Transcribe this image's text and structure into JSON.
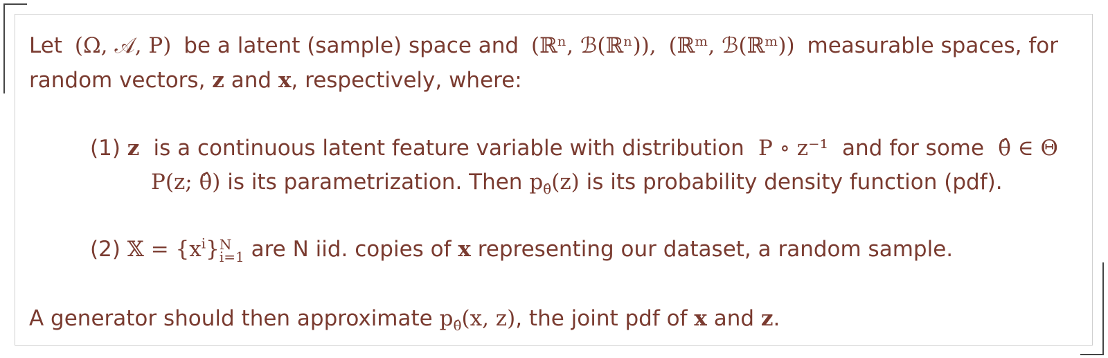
{
  "intro": {
    "w1": "Let",
    "m1": "(Ω, 𝒜, P)",
    "w2": "be a latent (sample) space and",
    "m2": "(ℝⁿ, ℬ(ℝⁿ)),",
    "m3": "(ℝᵐ, ℬ(ℝᵐ))",
    "w3": "measurable spaces, for",
    "line2a": "random vectors,",
    "z": "z",
    "line2b": "and",
    "x": "x",
    "line2c": ", respectively, where:"
  },
  "item1": {
    "number": "(1)",
    "z": "z",
    "text1": "is a continuous latent feature variable with distribution",
    "dist": "P ∘ z⁻¹",
    "text2": "and for some",
    "theta_in": "θ̂ ∈ Θ",
    "param": "P(z; θ̂)",
    "text3": "is its parametrization. Then",
    "pdf_sym": "p",
    "pdf_sub": "θ̂",
    "pdf_arg": "(z)",
    "text4": "is its probability density function (pdf)."
  },
  "item2": {
    "number": "(2)",
    "set": "𝕏 = {x",
    "sup_i": "i",
    "close": "}",
    "sub_range": "i=1",
    "sup_N": "N",
    "text": "are N iid. copies of",
    "x": "x",
    "text2": "representing our dataset, a random sample."
  },
  "conclusion": {
    "text1": "A generator should then approximate",
    "pdf_sym": "p",
    "pdf_sub": "θ̂",
    "pdf_arg": "(x, z)",
    "text2": ", the joint pdf of",
    "x": "x",
    "and": "and",
    "z": "z",
    "end": "."
  }
}
